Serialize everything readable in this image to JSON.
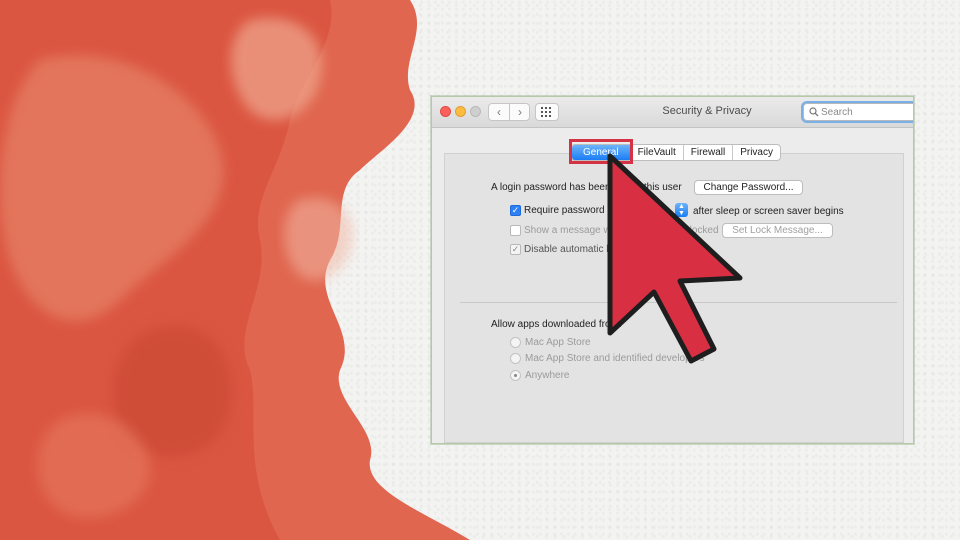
{
  "window": {
    "title": "Security & Privacy",
    "search_placeholder": "Search"
  },
  "tabs": [
    {
      "label": "General",
      "active": true
    },
    {
      "label": "FileVault",
      "active": false
    },
    {
      "label": "Firewall",
      "active": false
    },
    {
      "label": "Privacy",
      "active": false
    }
  ],
  "general": {
    "login_password_text": "A login password has been set for this user",
    "change_password_label": "Change Password...",
    "require_password_label": "Require password",
    "require_password_checked": true,
    "after_sleep_text": "after sleep or screen saver begins",
    "show_message_label": "Show a message when the screen is locked",
    "set_lock_message_label": "Set Lock Message...",
    "disable_auto_login_label": "Disable automatic login",
    "disable_auto_login_checked": true
  },
  "downloads": {
    "heading": "Allow apps downloaded from:",
    "options": [
      {
        "label": "Mac App Store",
        "selected": false
      },
      {
        "label": "Mac App Store and identified developers",
        "selected": false
      },
      {
        "label": "Anywhere",
        "selected": true
      }
    ]
  },
  "colors": {
    "accent_blue": "#1b7df5",
    "highlight_red": "#d43345",
    "cursor_red": "#d92f43"
  }
}
